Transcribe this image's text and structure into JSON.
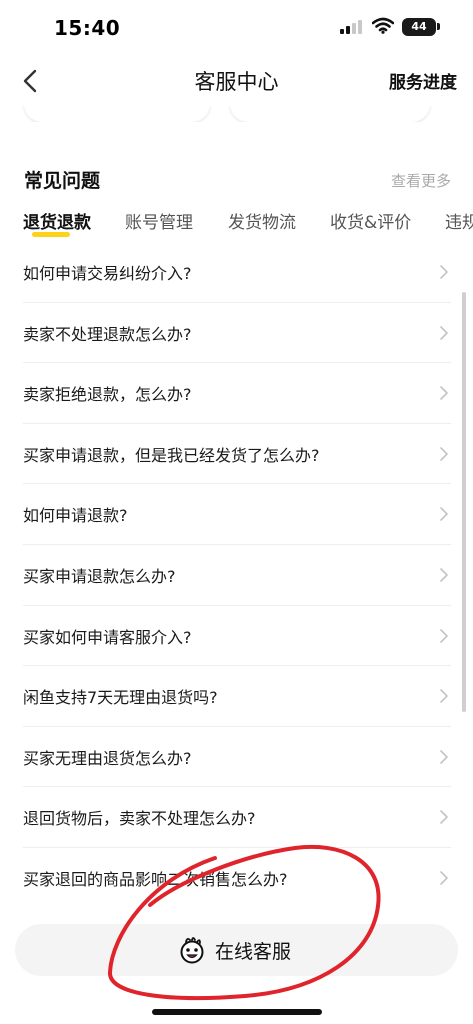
{
  "status_bar": {
    "time": "15:40",
    "battery": "44",
    "signal_icon": "cellular-signal-icon",
    "wifi_icon": "wifi-icon"
  },
  "nav": {
    "back_icon": "chevron-left-icon",
    "title": "客服中心",
    "right_action": "服务进度"
  },
  "faq_section": {
    "title": "常见问题",
    "more": "查看更多"
  },
  "tabs": [
    {
      "label": "退货退款",
      "active": true
    },
    {
      "label": "账号管理",
      "active": false
    },
    {
      "label": "发货物流",
      "active": false
    },
    {
      "label": "收货&评价",
      "active": false
    },
    {
      "label": "违规",
      "active": false
    }
  ],
  "faq_items": [
    "如何申请交易纠纷介入?",
    "卖家不处理退款怎么办?",
    "卖家拒绝退款，怎么办?",
    "买家申请退款，但是我已经发货了怎么办?",
    "如何申请退款?",
    "买家申请退款怎么办?",
    "买家如何申请客服介入?",
    "闲鱼支持7天无理由退货吗?",
    "买家无理由退货怎么办?",
    "退回货物后，卖家不处理怎么办?",
    "买家退回的商品影响二次销售怎么办?"
  ],
  "bottom_action": {
    "label": "在线客服",
    "icon": "mascot-face-icon"
  },
  "colors": {
    "accent": "#ffd21a",
    "annotation": "#e0242b",
    "muted": "#aaaaaa"
  }
}
